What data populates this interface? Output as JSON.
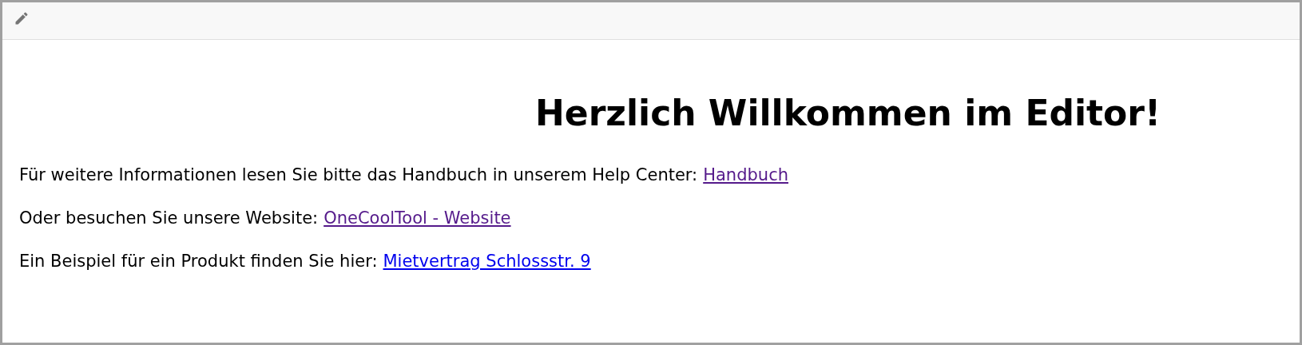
{
  "toolbar": {
    "edit_icon": true
  },
  "heading": "Herzlich Willkommen im Editor!",
  "paragraphs": [
    {
      "text": "Für weitere Informationen lesen Sie bitte das Handbuch in unserem Help Center:",
      "link": {
        "label": "Handbuch",
        "visited": true
      }
    },
    {
      "text": "Oder besuchen Sie unsere Website:",
      "link": {
        "label": "OneCoolTool - Website",
        "visited": true
      }
    },
    {
      "text": "Ein Beispiel für ein Produkt finden Sie hier:",
      "link": {
        "label": "Mietvertrag Schlossstr. 9",
        "visited": false
      }
    }
  ]
}
